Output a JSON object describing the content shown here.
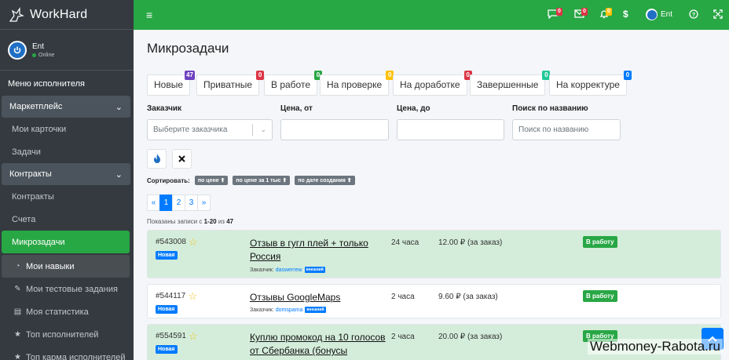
{
  "brand": {
    "name": "WorkHard"
  },
  "user": {
    "name": "Ent",
    "status": "Online"
  },
  "sidebar": {
    "header": "Меню исполнителя",
    "groups": [
      {
        "label": "Маркетплейс",
        "items": [
          "Мои карточки",
          "Задачи"
        ]
      },
      {
        "label": "Контракты",
        "items": [
          "Контракты",
          "Счета",
          "Микрозадачи"
        ]
      }
    ],
    "sub_items": [
      {
        "label": "Мои навыки",
        "icon": "dashboard-icon"
      },
      {
        "label": "Мои тестовые задания",
        "icon": "pencil-icon"
      },
      {
        "label": "Моя статистика",
        "icon": "chart-icon"
      },
      {
        "label": "Топ исполнителей",
        "icon": "star-icon"
      },
      {
        "label": "Топ карма исполнителей",
        "icon": "star-icon"
      }
    ]
  },
  "topbar": {
    "badges": {
      "chat": "0",
      "mail": "0",
      "bell": "0"
    },
    "currency": "$",
    "user": "Ent",
    "colors": {
      "bar": "#28a745",
      "chat": "#dc3545",
      "mail": "#dc3545",
      "bell": "#ffc107"
    }
  },
  "page": {
    "title": "Микрозадачи"
  },
  "tabs": [
    {
      "label": "Новые",
      "count": "47",
      "color": "#6f42c1"
    },
    {
      "label": "Приватные",
      "count": "0",
      "color": "#dc3545"
    },
    {
      "label": "В работе",
      "count": "0",
      "color": "#28a745"
    },
    {
      "label": "На проверке",
      "count": "0",
      "color": "#ffc107"
    },
    {
      "label": "На доработке",
      "count": "0",
      "color": "#dc3545"
    },
    {
      "label": "Завершенные",
      "count": "0",
      "color": "#20c997"
    },
    {
      "label": "На корректуре",
      "count": "0",
      "color": "#007bff"
    }
  ],
  "filters": {
    "customer_label": "Заказчик",
    "customer_placeholder": "Выберите заказчика",
    "price_from_label": "Цена, от",
    "price_to_label": "Цена, до",
    "search_label": "Поиск по названию",
    "search_placeholder": "Поиск по названию"
  },
  "sort": {
    "label": "Сортировать:",
    "options": [
      "по цене ⬆",
      "по цене за 1 тыс ⬆",
      "по дате создания ⬆"
    ]
  },
  "pagination": {
    "prev": "«",
    "pages": [
      "1",
      "2",
      "3"
    ],
    "next": "»",
    "current": "1"
  },
  "shown": {
    "prefix": "Показаны записи с ",
    "range": "1-20",
    "mid": " из ",
    "total": "47"
  },
  "tasks": [
    {
      "id": "#543008",
      "badge": "Новая",
      "title": "Отзыв в гугл плей + только Россия",
      "customer_label": "Заказчик:",
      "customer": "daswerrew",
      "external": "внешний",
      "time": "24 часа",
      "price": "12.00 ₽ (за заказ)",
      "action": "В работу"
    },
    {
      "id": "#544117",
      "badge": "Новая",
      "title": "Отзывы GoogleMaps",
      "customer_label": "Заказчик:",
      "customer": "domspama",
      "external": "внешний",
      "time": "2 часа",
      "price": "9.60 ₽ (за заказ)",
      "action": "В работу"
    },
    {
      "id": "#554591",
      "badge": "Новая",
      "title": "Куплю промокод на 10 голосов от Сбербанка (бонусы",
      "time": "2 часа",
      "price": "20.00 ₽ (за заказ)",
      "action": "В работу"
    }
  ],
  "watermark": "Webmoney-Rabota.ru"
}
